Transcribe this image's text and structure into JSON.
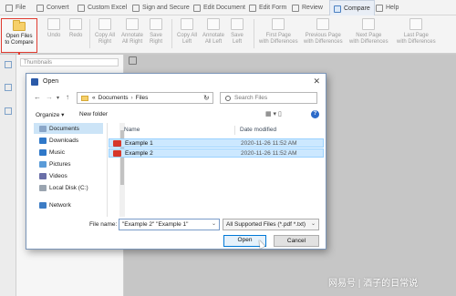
{
  "tabs": [
    {
      "label": "File"
    },
    {
      "label": "Convert"
    },
    {
      "label": "Custom Excel"
    },
    {
      "label": "Sign and Secure"
    },
    {
      "label": "Edit Document"
    },
    {
      "label": "Edit Form"
    },
    {
      "label": "Review"
    },
    {
      "label": "Compare"
    },
    {
      "label": "Help"
    }
  ],
  "ribbon": {
    "open_files": "Open Files\nto Compare",
    "undo": "Undo",
    "redo": "Redo",
    "copy_all_right": "Copy All\nRight",
    "annotate_all_right": "Annotate\nAll Right",
    "save_right": "Save\nRight",
    "copy_all_left": "Copy All\nLeft",
    "annotate_all_left": "Annotate\nAll Left",
    "save_left": "Save\nLeft",
    "first_page": "First Page\nwith Differences",
    "previous_page": "Previous Page\nwith Differences",
    "next_page": "Next Page\nwith Differences",
    "last_page": "Last Page\nwith Differences"
  },
  "thumbnails_label": "Thumbnails",
  "dialog": {
    "title": "Open",
    "close": "✕",
    "path": [
      "Documents",
      "Files"
    ],
    "path_prefix": "«",
    "search_placeholder": "Search Files",
    "organize": "Organize ▾",
    "new_folder": "New folder",
    "view_icons": "▦ ▾  ▯",
    "help": "?",
    "nav_items": [
      {
        "label": "Documents",
        "color": "#8aa6c8"
      },
      {
        "label": "Downloads",
        "color": "#2f78c9"
      },
      {
        "label": "Music",
        "color": "#2f78c9"
      },
      {
        "label": "Pictures",
        "color": "#5a9bd8"
      },
      {
        "label": "Videos",
        "color": "#6a6fa8"
      },
      {
        "label": "Local Disk (C:)",
        "color": "#9aa4b0"
      },
      {
        "label": "Network",
        "color": "#3d7cc4"
      }
    ],
    "columns": {
      "name": "Name",
      "date": "Date modified"
    },
    "files": [
      {
        "name": "Example 1",
        "date": "2020-11-26 11:52 AM"
      },
      {
        "name": "Example 2",
        "date": "2020-11-26 11:52 AM"
      }
    ],
    "file_name_label": "File name:",
    "file_name_value": "\"Example 2\" \"Example 1\"",
    "filter": "All Supported Files (*.pdf *.txt)",
    "open_button": "Open",
    "cancel_button": "Cancel"
  },
  "watermark": "网易号 | 酒子的日常说"
}
